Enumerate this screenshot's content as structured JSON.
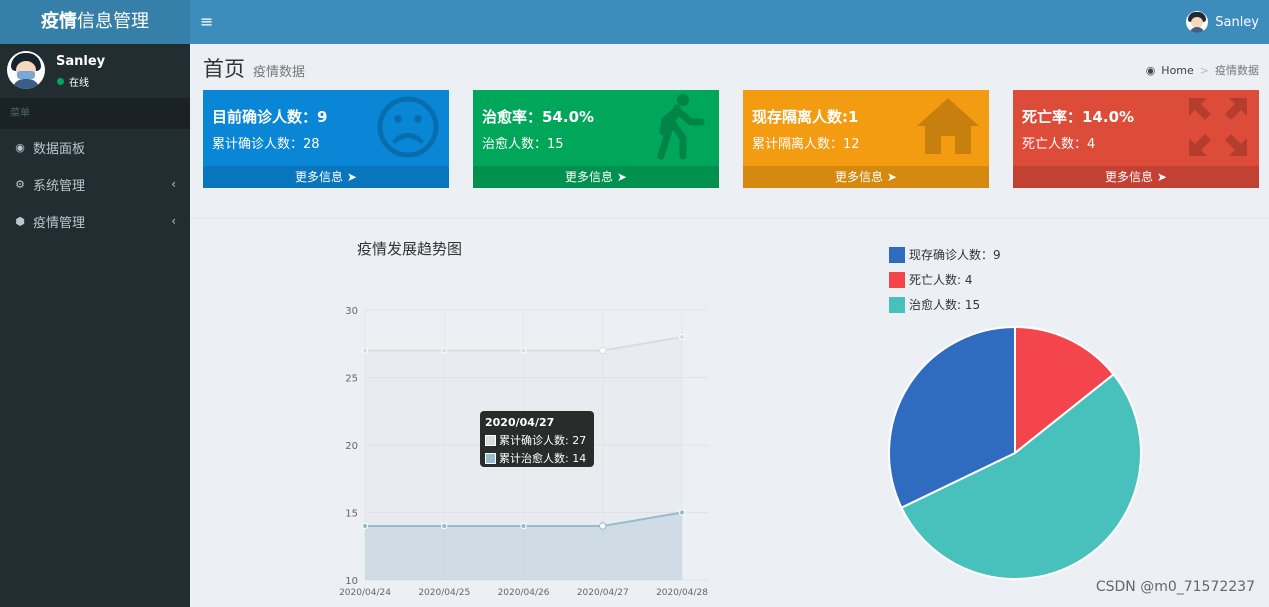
{
  "header": {
    "logo_bold": "疫情",
    "logo_rest": "信息管理",
    "username": "Sanley"
  },
  "sidebar": {
    "user_name": "Sanley",
    "status": "在线",
    "menu_header": "菜单",
    "items": [
      {
        "label": "数据面板",
        "icon": "dashboard-icon",
        "has_submenu": false
      },
      {
        "label": "系统管理",
        "icon": "cogs-icon",
        "has_submenu": true
      },
      {
        "label": "疫情管理",
        "icon": "cube-icon",
        "has_submenu": true
      }
    ]
  },
  "content": {
    "title": "首页",
    "subtitle": "疫情数据",
    "breadcrumb_home": "Home",
    "breadcrumb_current": "疫情数据"
  },
  "boxes": [
    {
      "line1": "目前确诊人数：9",
      "line2": "累计确诊人数：28",
      "footer": "更多信息",
      "icon": "frown-icon",
      "color": "#0a86d6"
    },
    {
      "line1": "治愈率：54.0%",
      "line2": "治愈人数：15",
      "footer": "更多信息",
      "icon": "walking-icon",
      "color": "#00a65a"
    },
    {
      "line1": "现存隔离人数:1",
      "line2": "累计隔离人数：12",
      "footer": "更多信息",
      "icon": "home-icon",
      "color": "#f39c12"
    },
    {
      "line1": "死亡率：14.0%",
      "line2": "死亡人数：4",
      "footer": "更多信息",
      "icon": "expand-icon",
      "color": "#dd4b39"
    }
  ],
  "chart_data": [
    {
      "type": "line",
      "title": "疫情发展趋势图",
      "x": [
        "2020/04/24",
        "2020/04/25",
        "2020/04/26",
        "2020/04/27",
        "2020/04/28"
      ],
      "ylim": [
        10,
        30
      ],
      "yticks": [
        10,
        15,
        20,
        25,
        30
      ],
      "series": [
        {
          "name": "累计确诊人数",
          "values": [
            27,
            27,
            27,
            27,
            28
          ],
          "color": "#dcdcdc"
        },
        {
          "name": "累计治愈人数",
          "values": [
            14,
            14,
            14,
            14,
            15
          ],
          "color": "#97bbcd"
        }
      ],
      "tooltip": {
        "title": "2020/04/27",
        "rows": [
          "累计确诊人数: 27",
          "累计治愈人数: 14"
        ]
      },
      "grid": true
    },
    {
      "type": "pie",
      "labels": [
        "现存确诊人数",
        "死亡人数",
        "治愈人数"
      ],
      "values": [
        9,
        4,
        15
      ],
      "legend_text": [
        "现存确诊人数：9",
        "死亡人数: 4",
        "治愈人数: 15"
      ],
      "colors": [
        "#2f6bbf",
        "#f4454c",
        "#48c0bc"
      ],
      "legend": "top-left"
    }
  ],
  "watermark": "CSDN @m0_71572237"
}
